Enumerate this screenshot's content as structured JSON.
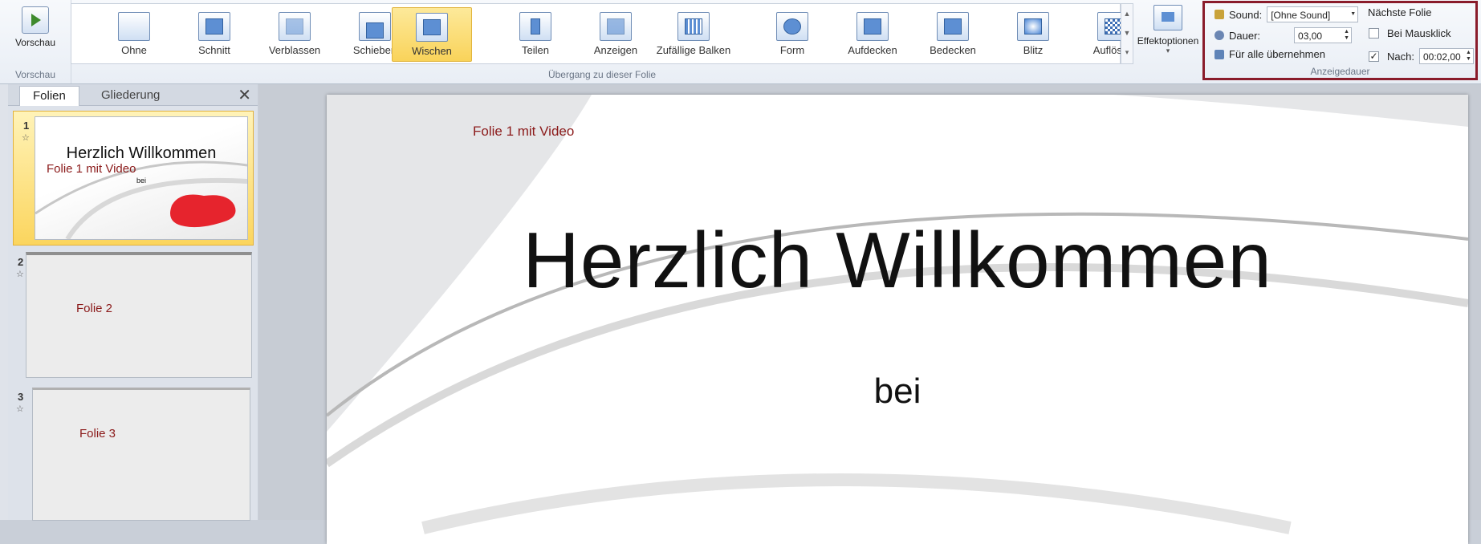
{
  "ribbon": {
    "preview": {
      "button_label": "Vorschau",
      "group_label": "Vorschau"
    },
    "transitions": {
      "group_label": "Übergang zu dieser Folie",
      "items": [
        "Ohne",
        "Schnitt",
        "Verblassen",
        "Schieben",
        "Wischen",
        "Teilen",
        "Anzeigen",
        "Zufällige Balken",
        "Form",
        "Aufdecken",
        "Bedecken",
        "Blitz",
        "Auflösen"
      ],
      "selected": "Wischen"
    },
    "effect_options": {
      "label": "Effektoptionen"
    },
    "timing": {
      "group_label": "Anzeigedauer",
      "sound_label": "Sound:",
      "sound_value": "[Ohne Sound]",
      "duration_label": "Dauer:",
      "duration_value": "03,00",
      "apply_all_label": "Für alle übernehmen",
      "next_slide_label": "Nächste Folie",
      "on_click_label": "Bei Mausklick",
      "on_click_checked": false,
      "after_label": "Nach:",
      "after_checked": true,
      "after_value": "00:02,00"
    }
  },
  "panel": {
    "tabs": [
      "Folien",
      "Gliederung"
    ],
    "active_tab": "Folien",
    "slides": [
      {
        "number": "1",
        "title": "Herzlich Willkommen",
        "subtitle": "Folie 1 mit Video",
        "extra": "bei",
        "selected": true
      },
      {
        "number": "2",
        "subtitle": "Folie 2",
        "selected": false
      },
      {
        "number": "3",
        "subtitle": "Folie 3",
        "selected": false
      }
    ]
  },
  "slide": {
    "caption": "Folie 1 mit Video",
    "title": "Herzlich Willkommen",
    "subtitle": "bei"
  },
  "colors": {
    "accent_selected": "#f9d35a",
    "timing_border": "#8a1c2b",
    "caption_red": "#8b1a1a"
  }
}
